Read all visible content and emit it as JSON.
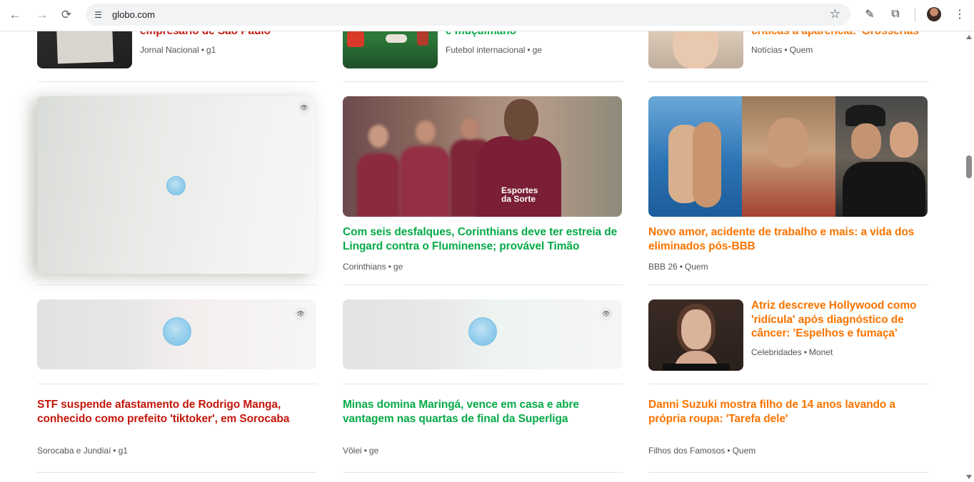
{
  "browser": {
    "url": "globo.com",
    "back_icon": "←",
    "forward_icon": "→",
    "reload_icon": "⟳",
    "site_info_icon": "☰",
    "star_icon": "☆",
    "extensions_icon": "⧉",
    "pen_icon": "✎",
    "menu_icon": "⋮"
  },
  "colors": {
    "g1": "#c4170c",
    "ge": "#06aa48",
    "gshow": "#fa7400"
  },
  "row0": [
    {
      "title": "empresário de São Paulo",
      "editoria": "Jornal Nacional",
      "source": "g1"
    },
    {
      "title": "e muçulmano",
      "editoria": "Futebol internacional",
      "source": "ge"
    },
    {
      "title": "críticas à aparência: 'Grosserias'",
      "editoria": "Notícias",
      "source": "Quem"
    }
  ],
  "row1": [
    {
      "ad_icon": "👁"
    },
    {
      "title": "Com seis desfalques, Corinthians deve ter estreia de Lingard contra o Fluminense; provável Timão",
      "editoria": "Corinthians",
      "source": "ge"
    },
    {
      "title": "Novo amor, acidente de trabalho e mais: a vida dos eliminados pós-BBB",
      "editoria": "BBB 26",
      "source": "Quem"
    }
  ],
  "row2": [
    {
      "ad_icon": "👁"
    },
    {
      "ad_icon": "👁"
    },
    {
      "title": "Atriz descreve Hollywood como 'ridícula' após diagnóstico de câncer: 'Espelhos e fumaça'",
      "editoria": "Celebridades",
      "source": "Monet"
    }
  ],
  "row3": [
    {
      "title": "STF suspende afastamento de Rodrigo Manga, conhecido como prefeito 'tiktoker', em Sorocaba",
      "editoria": "Sorocaba e Jundiaí",
      "source": "g1"
    },
    {
      "title": "Minas domina Maringá, vence em casa e abre vantagem nas quartas de final da Superliga",
      "editoria": "Vôlei",
      "source": "ge"
    },
    {
      "title": "Danni Suzuki mostra filho de 14 anos lavando a própria roupa: 'Tarefa dele'",
      "editoria": "Filhos dos Famosos",
      "source": "Quem"
    }
  ],
  "separator": "•"
}
